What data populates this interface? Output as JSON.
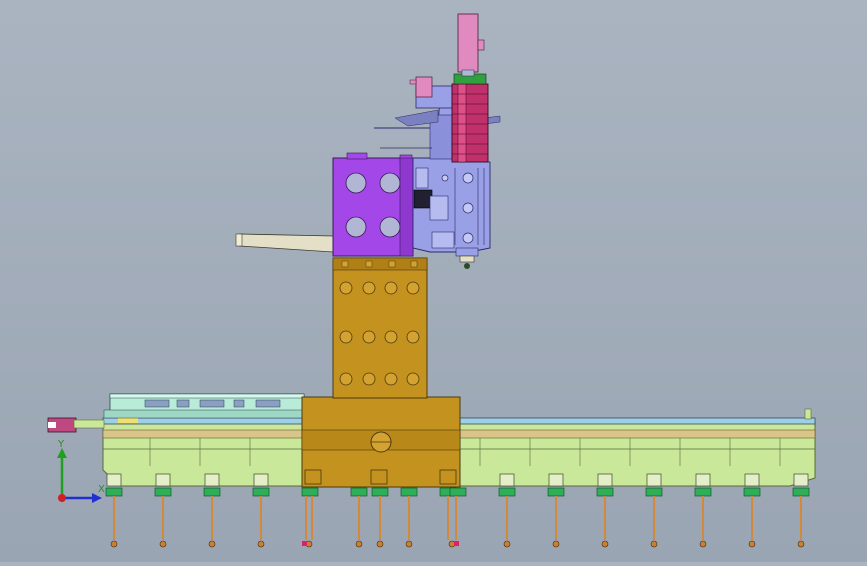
{
  "viewport": {
    "background_top": "#aab4c1",
    "background_bottom": "#9aa5b3"
  },
  "colors": {
    "bed": "#c9e89a",
    "bed_stroke": "#5a6a3a",
    "column": "#c4921e",
    "column_stroke": "#4a3a10",
    "head_block": "#a347e8",
    "head_block_stroke": "#3a1a5a",
    "spindle_assembly": "#9aa0e6",
    "spindle_stroke": "#2a2a6a",
    "spindle_housing": "#c0306a",
    "motor": "#e08ac0",
    "tool": "#e4e0c8",
    "cover": "#b8ecd8",
    "leveling_foot": "#2fae5a",
    "anchor_bolt": "#d4883a",
    "axis_x": "#2030d0",
    "axis_y": "#20a020",
    "axis_origin": "#d02020"
  },
  "axis_triad": {
    "y_label": "Y",
    "x_label": "X"
  }
}
